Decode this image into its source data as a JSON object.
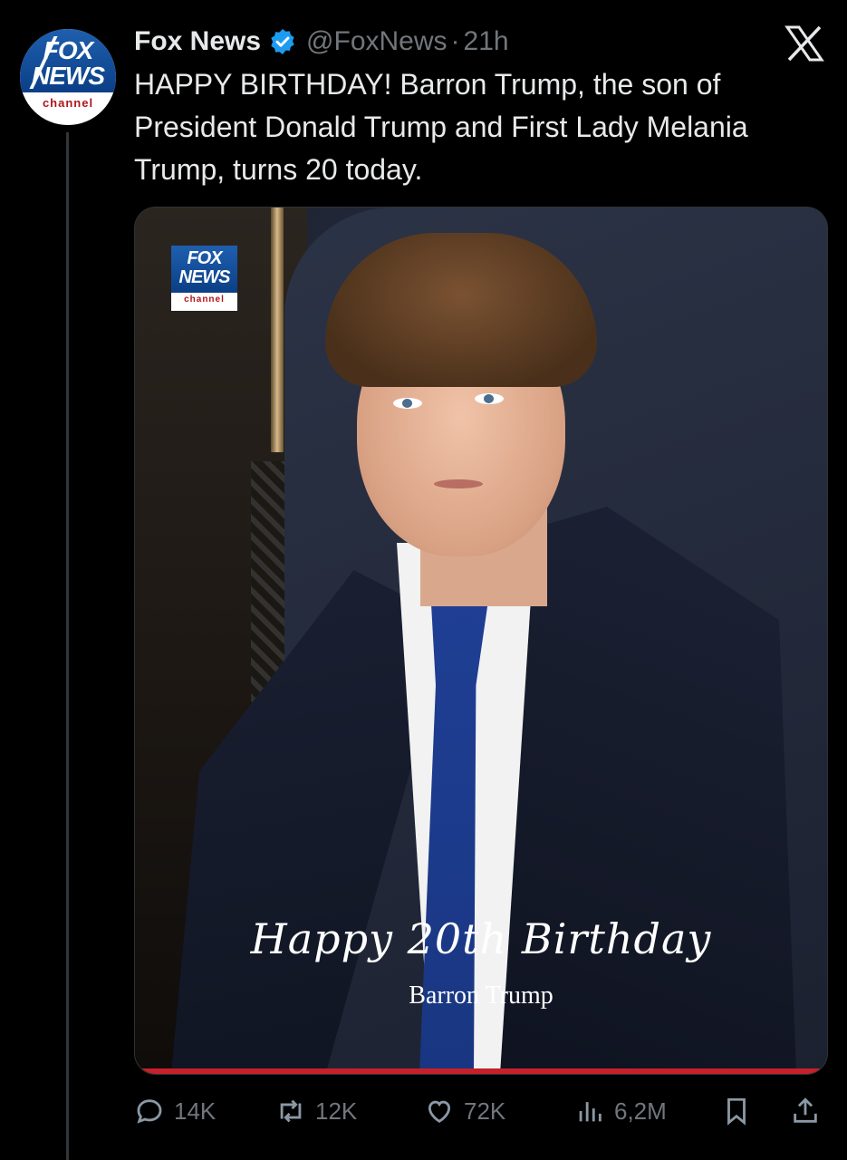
{
  "tweet": {
    "author": {
      "display_name": "Fox News",
      "verified": true,
      "handle": "@FoxNews",
      "separator": "·",
      "time": "21h",
      "avatar_icon": "fox-news-channel-logo",
      "avatar_text": [
        "FOX",
        "NEWS",
        "channel"
      ]
    },
    "text": "HAPPY BIRTHDAY! Barron Trump, the son of President Donald Trump and First Lady Melania Trump, turns 20 today.",
    "media": {
      "watermark_text": [
        "FOX",
        "NEWS",
        "channel"
      ],
      "caption_script": "Happy 20th Birthday",
      "caption_name": "Barron Trump"
    },
    "actions": {
      "reply_count": "14K",
      "retweet_count": "12K",
      "like_count": "72K",
      "views_count": "6,2M"
    }
  },
  "platform": {
    "logo_icon": "x-logo-icon"
  },
  "colors": {
    "background": "#000000",
    "text": "#e7e9ea",
    "muted": "#71767b",
    "verified_blue": "#1d9bf0",
    "accent_red": "#c6202b"
  }
}
